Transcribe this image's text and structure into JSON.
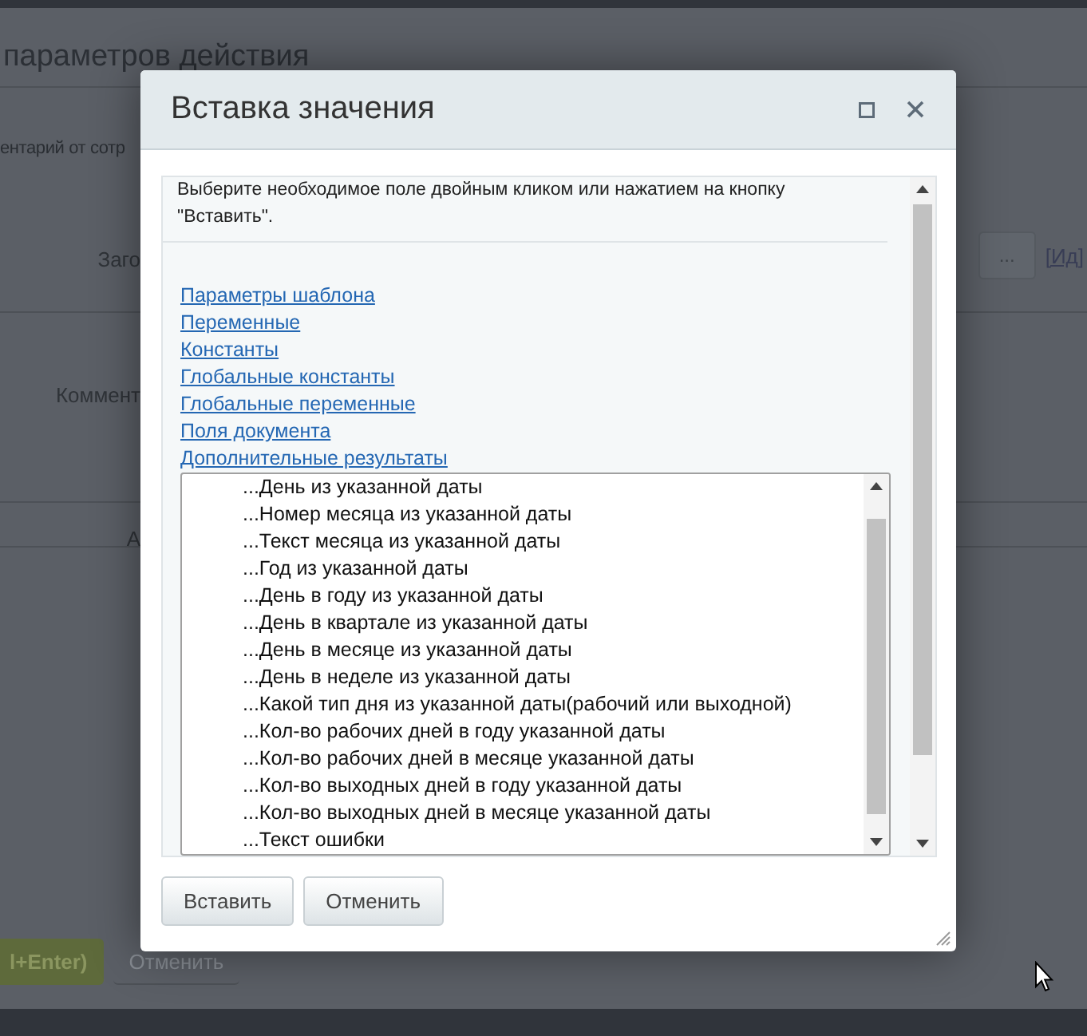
{
  "background_page": {
    "title": "параметров действия",
    "subtitle": "ентарий от сотр",
    "rows": [
      {
        "label": "Заго",
        "kind": "picker"
      },
      {
        "label": "Коммент",
        "kind": "text"
      },
      {
        "label": "А",
        "kind": "line"
      }
    ],
    "more_button": "...",
    "link": "[Ид]",
    "buttons": [
      {
        "label": "l+Enter)",
        "kind": "primary"
      },
      {
        "label": "Отменить",
        "kind": "secondary"
      }
    ]
  },
  "dialog": {
    "title": "Вставка значения",
    "hint": "Выберите необходимое поле двойным кликом или нажатием на кнопку \"Вставить\".",
    "sections": [
      "Параметры шаблона",
      "Переменные",
      "Константы",
      "Глобальные константы",
      "Глобальные переменные",
      "Поля документа",
      "Дополнительные результаты"
    ],
    "options": [
      "...День из указанной даты",
      "...Номер месяца из указанной даты",
      "...Текст месяца из указанной даты",
      "...Год из указанной даты",
      "...День в году из указанной даты",
      "...День в квартале из указанной даты",
      "...День в месяце из указанной даты",
      "...День в неделе из указанной даты",
      "...Какой тип дня из указанной даты(рабочий или выходной)",
      "...Кол-во рабочих дней в году указанной даты",
      "...Кол-во рабочих дней в месяце указанной даты",
      "...Кол-во выходных дней в году указанной даты",
      "...Кол-во выходных дней в месяце указанной даты",
      "...Текст ошибки"
    ],
    "buttons": [
      "Вставить",
      "Отменить"
    ]
  }
}
